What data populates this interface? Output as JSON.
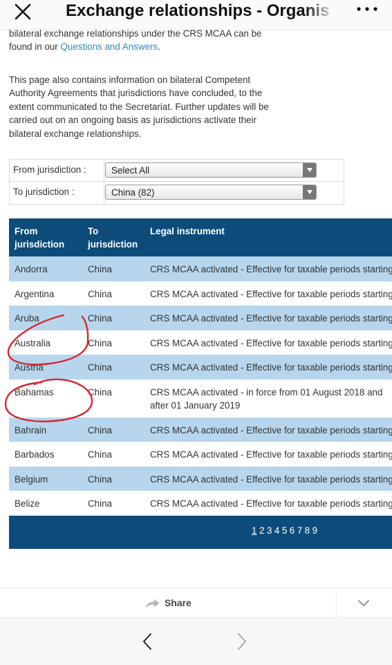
{
  "header": {
    "title": "Exchange relationships - Organis",
    "close_icon": "close-icon",
    "more_icon": "more-icon"
  },
  "intro": {
    "p1_text": "bilateral exchange relationships under the CRS MCAA can be found in our ",
    "p1_link": "Questions and Answers",
    "p1_end": ".",
    "p2": "This page also contains information on bilateral Competent Authority Agreements that jurisdictions have concluded, to the extent communicated to the Secretariat. Further updates will be carried out on an ongoing basis as jurisdictions activate their bilateral exchange relationships."
  },
  "filters": {
    "from_label": "From jurisdiction :",
    "from_value": "Select All",
    "to_label": "To jurisdiction :",
    "to_value": "China (82)"
  },
  "table": {
    "headers": {
      "from": [
        "From",
        "jurisdiction"
      ],
      "to": [
        "To",
        "jurisdiction"
      ],
      "instrument": "Legal instrument"
    },
    "rows": [
      {
        "from": "Andorra",
        "to": "China",
        "instrument": [
          "CRS MCAA activated - Effective for taxable periods starting"
        ]
      },
      {
        "from": "Argentina",
        "to": "China",
        "instrument": [
          "CRS MCAA activated - Effective for taxable periods starting"
        ]
      },
      {
        "from": "Aruba",
        "to": "China",
        "instrument": [
          "CRS MCAA activated - Effective for taxable periods starting"
        ]
      },
      {
        "from": "Australia",
        "to": "China",
        "instrument": [
          "CRS MCAA activated - Effective for taxable periods starting"
        ]
      },
      {
        "from": "Austria",
        "to": "China",
        "instrument": [
          "CRS MCAA activated - Effective for taxable periods starting"
        ]
      },
      {
        "from": "Bahamas",
        "to": "China",
        "instrument": [
          "CRS MCAA activated - in force from 01 August 2018 and",
          "after 01 January 2019"
        ]
      },
      {
        "from": "Bahrain",
        "to": "China",
        "instrument": [
          "CRS MCAA activated - Effective for taxable periods starting"
        ]
      },
      {
        "from": "Barbados",
        "to": "China",
        "instrument": [
          "CRS MCAA activated - Effective for taxable periods starting"
        ]
      },
      {
        "from": "Belgium",
        "to": "China",
        "instrument": [
          "CRS MCAA activated - Effective for taxable periods starting"
        ]
      },
      {
        "from": "Belize",
        "to": "China",
        "instrument": [
          "CRS MCAA activated - Effective for taxable periods starting"
        ]
      }
    ],
    "pages": [
      "1",
      "2",
      "3",
      "4",
      "5",
      "6",
      "7",
      "8",
      "9"
    ],
    "current_page": "1"
  },
  "sharebar": {
    "share_label": "Share",
    "share_icon": "share-arrow-icon",
    "collapse_icon": "chevron-down-icon"
  },
  "nav": {
    "back_icon": "chevron-left-icon",
    "forward_icon": "chevron-right-icon"
  },
  "colors": {
    "table_header": "#0d4c7a",
    "row_alt": "#b7d6ee",
    "link": "#2f8bb0",
    "annotation": "#d9262e"
  }
}
